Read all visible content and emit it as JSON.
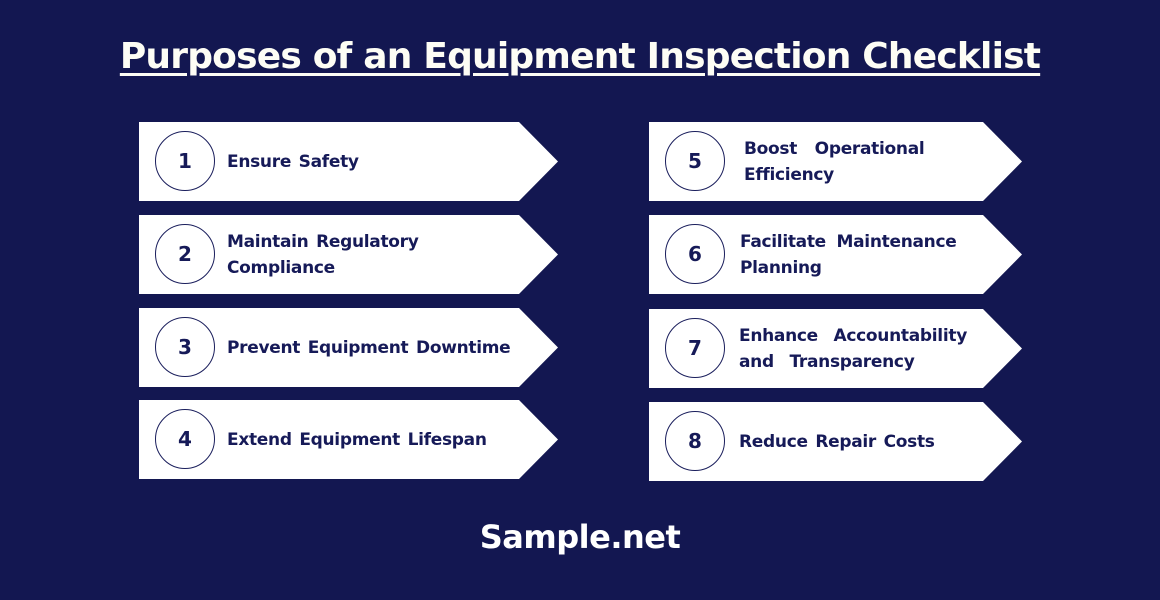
{
  "title": "Purposes of an Equipment Inspection Checklist",
  "colors": {
    "background": "#131751",
    "card": "#ffffff",
    "text_dark": "#161a58",
    "title_text": "#fdfdf5"
  },
  "items": [
    {
      "number": "1",
      "label": "Ensure Safety"
    },
    {
      "number": "2",
      "label": "Maintain Regulatory Compliance"
    },
    {
      "number": "3",
      "label": "Prevent Equipment Downtime"
    },
    {
      "number": "4",
      "label": "Extend Equipment Lifespan"
    },
    {
      "number": "5",
      "label": "Boost Operational Efficiency"
    },
    {
      "number": "6",
      "label": "Facilitate Maintenance Planning"
    },
    {
      "number": "7",
      "label": "Enhance Accountability and Transparency"
    },
    {
      "number": "8",
      "label": "Reduce Repair Costs"
    }
  ],
  "footer": "Sample.net"
}
